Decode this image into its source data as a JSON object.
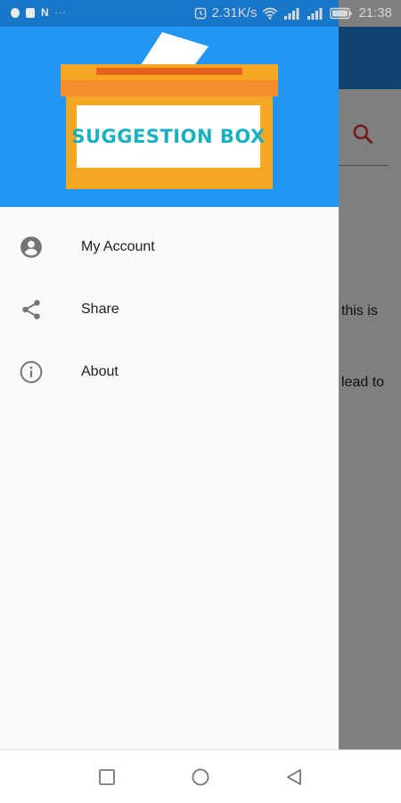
{
  "status_bar": {
    "network_speed": "2.31K/s",
    "time": "21:38",
    "left_indicator": "N",
    "left_icons": [
      "shield-icon",
      "sim-icon",
      "notification-n-icon",
      "overflow-dots-icon"
    ],
    "right_icons": [
      "alarm-icon",
      "wifi-icon",
      "signal-icon",
      "signal-icon",
      "battery-icon"
    ]
  },
  "app": {
    "toolbar_color": "#1f88e5",
    "search_icon": "search-icon",
    "content_fragment_1": "this is",
    "content_fragment_2": "lead to"
  },
  "drawer": {
    "header_color": "#2196f3",
    "logo": {
      "text": "SUGGESTION BOX",
      "box_color": "#f5a623",
      "lid_color": "#f58d2e",
      "text_color": "#17b1c0"
    },
    "items": [
      {
        "label": "My Account",
        "icon": "account-circle-icon"
      },
      {
        "label": "Share",
        "icon": "share-icon"
      },
      {
        "label": "About",
        "icon": "info-icon"
      }
    ]
  },
  "nav_bar": {
    "buttons": [
      "recents-square-icon",
      "home-circle-icon",
      "back-triangle-icon"
    ]
  }
}
